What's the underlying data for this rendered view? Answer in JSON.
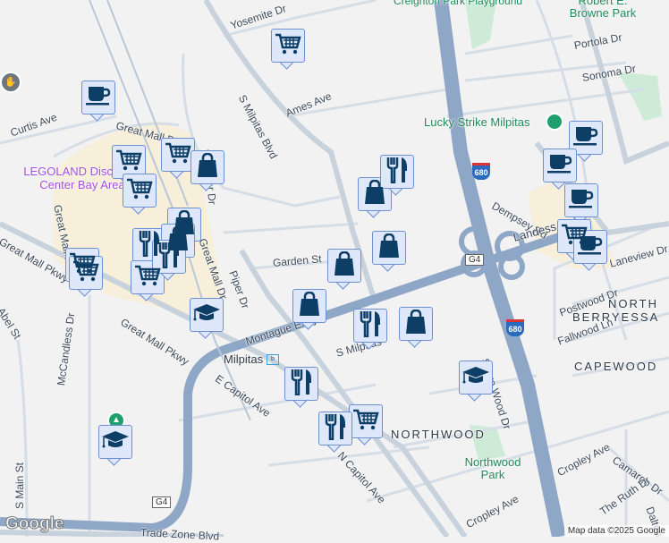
{
  "map": {
    "streets": {
      "yosemite": "Yosemite Dr",
      "s_milpitas_blvd": "S Milpitas Blvd",
      "ames": "Ames Ave",
      "curtis": "Curtis Ave",
      "great_mall_dr_n": "Great Mall Dr",
      "great_mall_dr_w": "Great Mall Dr",
      "great_mall_dr_e": "Great Mall Dr",
      "gibraltar": "Gibraltar Dr",
      "great_mall_pkwy_w": "Great Mall Pkwy",
      "great_mall_pkwy": "Great Mall Pkwy",
      "piper": "Piper Dr",
      "garden": "Garden St",
      "montague": "Montague Expy",
      "s_milpitas": "S Milpitas",
      "abel": "Abel St",
      "mccandless": "McCandless Dr",
      "e_capitol": "E Capitol Ave",
      "n_capitol": "N Capitol Ave",
      "s_main": "S Main St",
      "trade_zone": "Trade Zone Blvd",
      "portola": "Portola Dr",
      "sonoma": "Sonoma Dr",
      "dempsey": "Dempsey Rd",
      "landess": "Landess Ave",
      "laneview": "Laneview Dr",
      "postwood": "Postwood Dr",
      "fallwood": "Fallwood Ln",
      "sierra_wood": "Sierra Wood Dr",
      "cropley_e": "Cropley Ave",
      "cropley_w": "Cropley Ave",
      "camargo": "Camargo Dr",
      "ruth": "The Ruth Dr",
      "dalton": "Dalton"
    },
    "highways": {
      "i680": "680",
      "g4_a": "G4",
      "g4_b": "G4"
    },
    "areas": {
      "north_berryessa_1": "NORTH",
      "north_berryessa_2": "BERRYESSA",
      "capewood": "CAPEWOOD",
      "northwood": "NORTHWOOD"
    },
    "places": {
      "playground": "Creighton Park Playground",
      "browne_park": "Robert E. Browne Park",
      "lucky_strike": "Lucky Strike Milpitas",
      "legoland": "LEGOLAND Discovery Center Bay Area",
      "northwood_park": "Northwood Park",
      "milpitas_station": "Milpitas"
    },
    "attribution": "Map data ©2025 Google",
    "logo": "Google"
  },
  "markers": [
    "cart-icon",
    "coffee-icon",
    "cart-icon",
    "cart-icon",
    "cart-icon",
    "bag-icon",
    "bag-icon",
    "bag-icon",
    "fork-knife-icon",
    "bag-icon",
    "fork-knife-icon",
    "cart-icon",
    "cart-icon",
    "cart-icon",
    "bag-icon",
    "bag-icon",
    "graduation-cap-icon",
    "fork-knife-icon",
    "bag-icon",
    "fork-knife-icon",
    "fork-knife-icon",
    "bag-icon",
    "cart-icon",
    "fork-knife-icon",
    "graduation-cap-icon",
    "graduation-cap-icon",
    "coffee-icon",
    "coffee-icon",
    "coffee-icon",
    "cart-icon",
    "coffee-icon"
  ]
}
